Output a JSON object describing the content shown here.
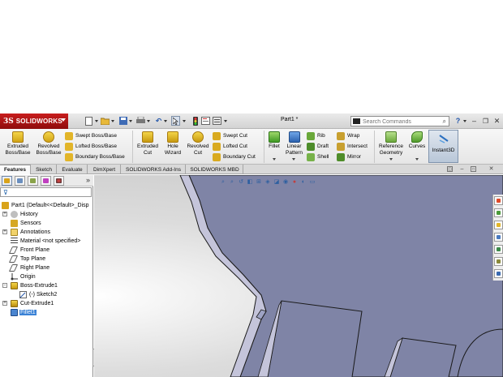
{
  "app": {
    "brand": "SOLIDWORKS",
    "brand_mark": "3S",
    "document_title": "Part1 *"
  },
  "search": {
    "placeholder": "Search Commands"
  },
  "titlebar_icons": [
    "new-icon",
    "open-icon",
    "save-icon",
    "print-icon",
    "undo-icon",
    "select-icon",
    "rebuild-icon",
    "file-properties-icon",
    "options-icon",
    "help-icon"
  ],
  "ribbon": {
    "extruded_boss": "Extruded Boss/Base",
    "revolved_boss": "Revolved Boss/Base",
    "swept_boss": "Swept Boss/Base",
    "lofted_boss": "Lofted Boss/Base",
    "boundary_boss": "Boundary Boss/Base",
    "extruded_cut": "Extruded Cut",
    "hole_wizard": "Hole Wizard",
    "revolved_cut": "Revolved Cut",
    "swept_cut": "Swept Cut",
    "lofted_cut": "Lofted Cut",
    "boundary_cut": "Boundary Cut",
    "fillet": "Fillet",
    "linear_pattern": "Linear Pattern",
    "rib": "Rib",
    "draft": "Draft",
    "shell": "Shell",
    "wrap": "Wrap",
    "intersect": "Intersect",
    "mirror": "Mirror",
    "reference_geometry": "Reference Geometry",
    "curves": "Curves",
    "instant3d": "Instant3D"
  },
  "tabs": [
    {
      "label": "Features",
      "active": true
    },
    {
      "label": "Sketch",
      "active": false
    },
    {
      "label": "Evaluate",
      "active": false
    },
    {
      "label": "DimXpert",
      "active": false
    },
    {
      "label": "SOLIDWORKS Add-Ins",
      "active": false
    },
    {
      "label": "SOLIDWORKS MBD",
      "active": false
    }
  ],
  "feature_tree": [
    {
      "label": "Part1  (Default<<Default>_Disp",
      "icon": "part-icon",
      "level": 0,
      "expand": ""
    },
    {
      "label": "History",
      "icon": "history-icon",
      "level": 1,
      "expand": "+"
    },
    {
      "label": "Sensors",
      "icon": "sensor-icon",
      "level": 1,
      "expand": ""
    },
    {
      "label": "Annotations",
      "icon": "annotation-icon",
      "level": 1,
      "expand": "+"
    },
    {
      "label": "Material <not specified>",
      "icon": "material-icon",
      "level": 1,
      "expand": ""
    },
    {
      "label": "Front Plane",
      "icon": "plane-icon",
      "level": 1,
      "expand": ""
    },
    {
      "label": "Top Plane",
      "icon": "plane-icon",
      "level": 1,
      "expand": ""
    },
    {
      "label": "Right Plane",
      "icon": "plane-icon",
      "level": 1,
      "expand": ""
    },
    {
      "label": "Origin",
      "icon": "origin-icon",
      "level": 1,
      "expand": ""
    },
    {
      "label": "Boss-Extrude1",
      "icon": "extrude-icon",
      "level": 1,
      "expand": "-"
    },
    {
      "label": "(-) Sketch2",
      "icon": "sketch-icon",
      "level": 2,
      "expand": ""
    },
    {
      "label": "Cut-Extrude1",
      "icon": "cut-extrude-icon",
      "level": 1,
      "expand": "+"
    },
    {
      "label": "Fillet1",
      "icon": "fillet-icon",
      "level": 1,
      "expand": "",
      "selected": true
    }
  ],
  "colors": {
    "brand_red": "#b71c1c",
    "selection": "#3a82d6",
    "model_face": "#7f84a6",
    "model_edge": "#1a1a1a",
    "model_side": "#c4c4da"
  }
}
